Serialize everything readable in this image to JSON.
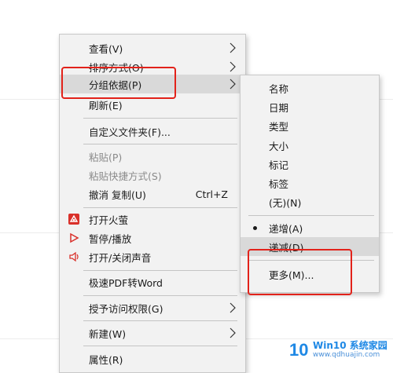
{
  "main_menu": {
    "items": [
      {
        "label": "查看(V)"
      },
      {
        "label": "排序方式(O)"
      },
      {
        "label": "分组依据(P)"
      },
      {
        "label": "刷新(E)"
      },
      {
        "label": "自定义文件夹(F)..."
      },
      {
        "label": "粘贴(P)"
      },
      {
        "label": "粘贴快捷方式(S)"
      },
      {
        "label": "撤消 复制(U)",
        "shortcut": "Ctrl+Z"
      },
      {
        "label": "打开火萤"
      },
      {
        "label": "暂停/播放"
      },
      {
        "label": "打开/关闭声音"
      },
      {
        "label": "极速PDF转Word"
      },
      {
        "label": "授予访问权限(G)"
      },
      {
        "label": "新建(W)"
      },
      {
        "label": "属性(R)"
      }
    ]
  },
  "sub_menu": {
    "items": [
      {
        "label": "名称"
      },
      {
        "label": "日期"
      },
      {
        "label": "类型"
      },
      {
        "label": "大小"
      },
      {
        "label": "标记"
      },
      {
        "label": "标签"
      },
      {
        "label": "(无)(N)"
      },
      {
        "label": "递增(A)"
      },
      {
        "label": "递减(D)"
      },
      {
        "label": "更多(M)..."
      }
    ]
  },
  "watermark": {
    "logo": "10",
    "title": "Win10 系统家园",
    "url": "www.qdhuajin.com"
  },
  "colors": {
    "highlight_box": "#e2221a",
    "menu_bg": "#f2f2f2",
    "hover_bg": "#d9d9d9"
  }
}
